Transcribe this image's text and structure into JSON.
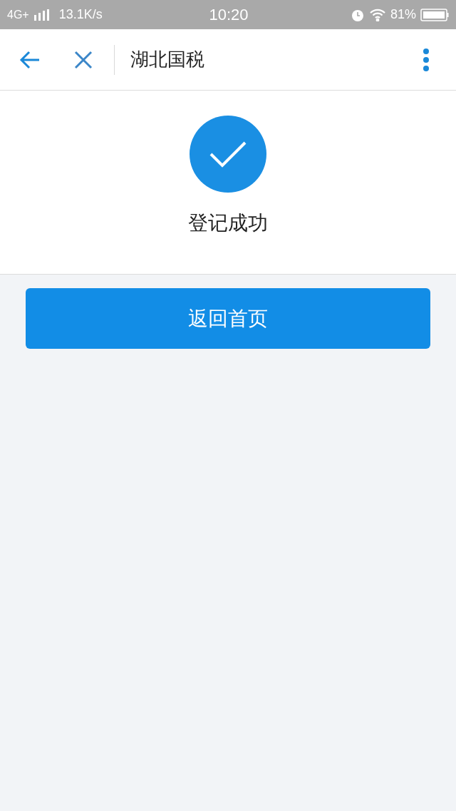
{
  "status_bar": {
    "network": "4G+",
    "speed": "13.1K/s",
    "time": "10:20",
    "battery": "81%"
  },
  "nav_bar": {
    "title": "湖北国税"
  },
  "result": {
    "message": "登记成功"
  },
  "home_button": {
    "label": "返回首页"
  }
}
